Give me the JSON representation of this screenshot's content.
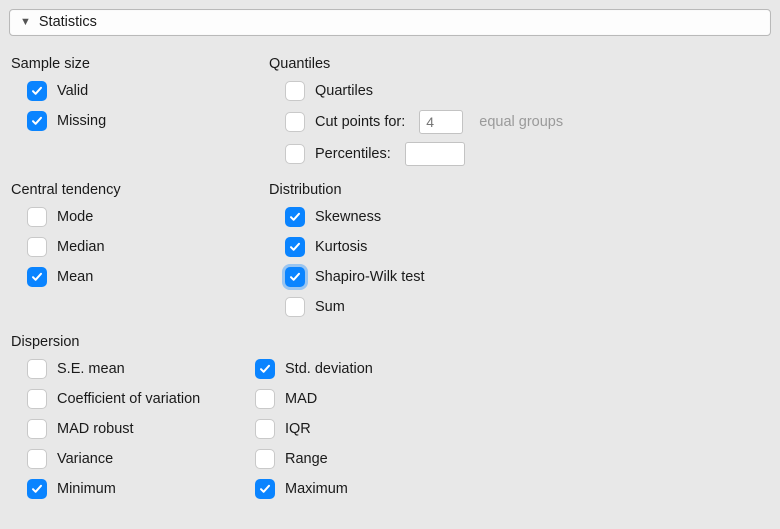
{
  "panel": {
    "title": "Statistics"
  },
  "sample_size": {
    "title": "Sample size",
    "valid": {
      "label": "Valid",
      "checked": true
    },
    "missing": {
      "label": "Missing",
      "checked": true
    }
  },
  "quantiles": {
    "title": "Quantiles",
    "quartiles": {
      "label": "Quartiles",
      "checked": false
    },
    "cut_points": {
      "label": "Cut points for:",
      "checked": false,
      "value": "4",
      "suffix": "equal groups"
    },
    "percentiles": {
      "label": "Percentiles:",
      "checked": false,
      "value": ""
    }
  },
  "central_tendency": {
    "title": "Central tendency",
    "mode": {
      "label": "Mode",
      "checked": false
    },
    "median": {
      "label": "Median",
      "checked": false
    },
    "mean": {
      "label": "Mean",
      "checked": true
    }
  },
  "distribution": {
    "title": "Distribution",
    "skewness": {
      "label": "Skewness",
      "checked": true
    },
    "kurtosis": {
      "label": "Kurtosis",
      "checked": true
    },
    "shapiro": {
      "label": "Shapiro-Wilk test",
      "checked": true,
      "focused": true
    },
    "sum": {
      "label": "Sum",
      "checked": false
    }
  },
  "dispersion": {
    "title": "Dispersion",
    "left": {
      "se_mean": {
        "label": "S.E. mean",
        "checked": false
      },
      "cv": {
        "label": "Coefficient of variation",
        "checked": false
      },
      "mad_robust": {
        "label": "MAD robust",
        "checked": false
      },
      "variance": {
        "label": "Variance",
        "checked": false
      },
      "minimum": {
        "label": "Minimum",
        "checked": true
      }
    },
    "right": {
      "std_dev": {
        "label": "Std. deviation",
        "checked": true
      },
      "mad": {
        "label": "MAD",
        "checked": false
      },
      "iqr": {
        "label": "IQR",
        "checked": false
      },
      "range": {
        "label": "Range",
        "checked": false
      },
      "maximum": {
        "label": "Maximum",
        "checked": true
      }
    }
  }
}
